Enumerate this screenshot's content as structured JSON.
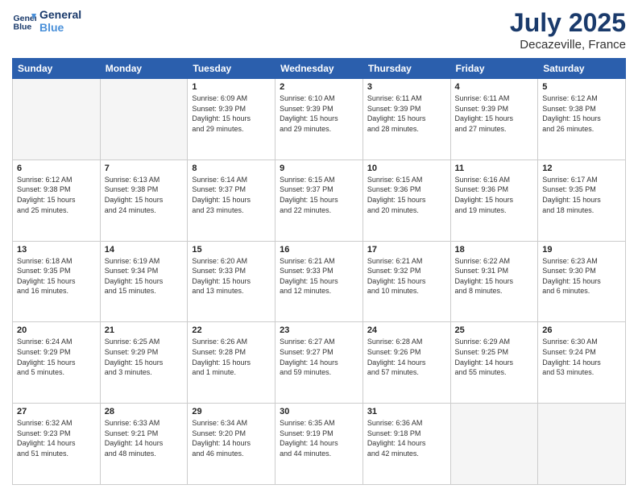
{
  "header": {
    "logo_line1": "General",
    "logo_line2": "Blue",
    "main_title": "July 2025",
    "sub_title": "Decazeville, France"
  },
  "days_of_week": [
    "Sunday",
    "Monday",
    "Tuesday",
    "Wednesday",
    "Thursday",
    "Friday",
    "Saturday"
  ],
  "weeks": [
    [
      {
        "day": "",
        "info": ""
      },
      {
        "day": "",
        "info": ""
      },
      {
        "day": "1",
        "info": "Sunrise: 6:09 AM\nSunset: 9:39 PM\nDaylight: 15 hours\nand 29 minutes."
      },
      {
        "day": "2",
        "info": "Sunrise: 6:10 AM\nSunset: 9:39 PM\nDaylight: 15 hours\nand 29 minutes."
      },
      {
        "day": "3",
        "info": "Sunrise: 6:11 AM\nSunset: 9:39 PM\nDaylight: 15 hours\nand 28 minutes."
      },
      {
        "day": "4",
        "info": "Sunrise: 6:11 AM\nSunset: 9:39 PM\nDaylight: 15 hours\nand 27 minutes."
      },
      {
        "day": "5",
        "info": "Sunrise: 6:12 AM\nSunset: 9:38 PM\nDaylight: 15 hours\nand 26 minutes."
      }
    ],
    [
      {
        "day": "6",
        "info": "Sunrise: 6:12 AM\nSunset: 9:38 PM\nDaylight: 15 hours\nand 25 minutes."
      },
      {
        "day": "7",
        "info": "Sunrise: 6:13 AM\nSunset: 9:38 PM\nDaylight: 15 hours\nand 24 minutes."
      },
      {
        "day": "8",
        "info": "Sunrise: 6:14 AM\nSunset: 9:37 PM\nDaylight: 15 hours\nand 23 minutes."
      },
      {
        "day": "9",
        "info": "Sunrise: 6:15 AM\nSunset: 9:37 PM\nDaylight: 15 hours\nand 22 minutes."
      },
      {
        "day": "10",
        "info": "Sunrise: 6:15 AM\nSunset: 9:36 PM\nDaylight: 15 hours\nand 20 minutes."
      },
      {
        "day": "11",
        "info": "Sunrise: 6:16 AM\nSunset: 9:36 PM\nDaylight: 15 hours\nand 19 minutes."
      },
      {
        "day": "12",
        "info": "Sunrise: 6:17 AM\nSunset: 9:35 PM\nDaylight: 15 hours\nand 18 minutes."
      }
    ],
    [
      {
        "day": "13",
        "info": "Sunrise: 6:18 AM\nSunset: 9:35 PM\nDaylight: 15 hours\nand 16 minutes."
      },
      {
        "day": "14",
        "info": "Sunrise: 6:19 AM\nSunset: 9:34 PM\nDaylight: 15 hours\nand 15 minutes."
      },
      {
        "day": "15",
        "info": "Sunrise: 6:20 AM\nSunset: 9:33 PM\nDaylight: 15 hours\nand 13 minutes."
      },
      {
        "day": "16",
        "info": "Sunrise: 6:21 AM\nSunset: 9:33 PM\nDaylight: 15 hours\nand 12 minutes."
      },
      {
        "day": "17",
        "info": "Sunrise: 6:21 AM\nSunset: 9:32 PM\nDaylight: 15 hours\nand 10 minutes."
      },
      {
        "day": "18",
        "info": "Sunrise: 6:22 AM\nSunset: 9:31 PM\nDaylight: 15 hours\nand 8 minutes."
      },
      {
        "day": "19",
        "info": "Sunrise: 6:23 AM\nSunset: 9:30 PM\nDaylight: 15 hours\nand 6 minutes."
      }
    ],
    [
      {
        "day": "20",
        "info": "Sunrise: 6:24 AM\nSunset: 9:29 PM\nDaylight: 15 hours\nand 5 minutes."
      },
      {
        "day": "21",
        "info": "Sunrise: 6:25 AM\nSunset: 9:29 PM\nDaylight: 15 hours\nand 3 minutes."
      },
      {
        "day": "22",
        "info": "Sunrise: 6:26 AM\nSunset: 9:28 PM\nDaylight: 15 hours\nand 1 minute."
      },
      {
        "day": "23",
        "info": "Sunrise: 6:27 AM\nSunset: 9:27 PM\nDaylight: 14 hours\nand 59 minutes."
      },
      {
        "day": "24",
        "info": "Sunrise: 6:28 AM\nSunset: 9:26 PM\nDaylight: 14 hours\nand 57 minutes."
      },
      {
        "day": "25",
        "info": "Sunrise: 6:29 AM\nSunset: 9:25 PM\nDaylight: 14 hours\nand 55 minutes."
      },
      {
        "day": "26",
        "info": "Sunrise: 6:30 AM\nSunset: 9:24 PM\nDaylight: 14 hours\nand 53 minutes."
      }
    ],
    [
      {
        "day": "27",
        "info": "Sunrise: 6:32 AM\nSunset: 9:23 PM\nDaylight: 14 hours\nand 51 minutes."
      },
      {
        "day": "28",
        "info": "Sunrise: 6:33 AM\nSunset: 9:21 PM\nDaylight: 14 hours\nand 48 minutes."
      },
      {
        "day": "29",
        "info": "Sunrise: 6:34 AM\nSunset: 9:20 PM\nDaylight: 14 hours\nand 46 minutes."
      },
      {
        "day": "30",
        "info": "Sunrise: 6:35 AM\nSunset: 9:19 PM\nDaylight: 14 hours\nand 44 minutes."
      },
      {
        "day": "31",
        "info": "Sunrise: 6:36 AM\nSunset: 9:18 PM\nDaylight: 14 hours\nand 42 minutes."
      },
      {
        "day": "",
        "info": ""
      },
      {
        "day": "",
        "info": ""
      }
    ]
  ]
}
